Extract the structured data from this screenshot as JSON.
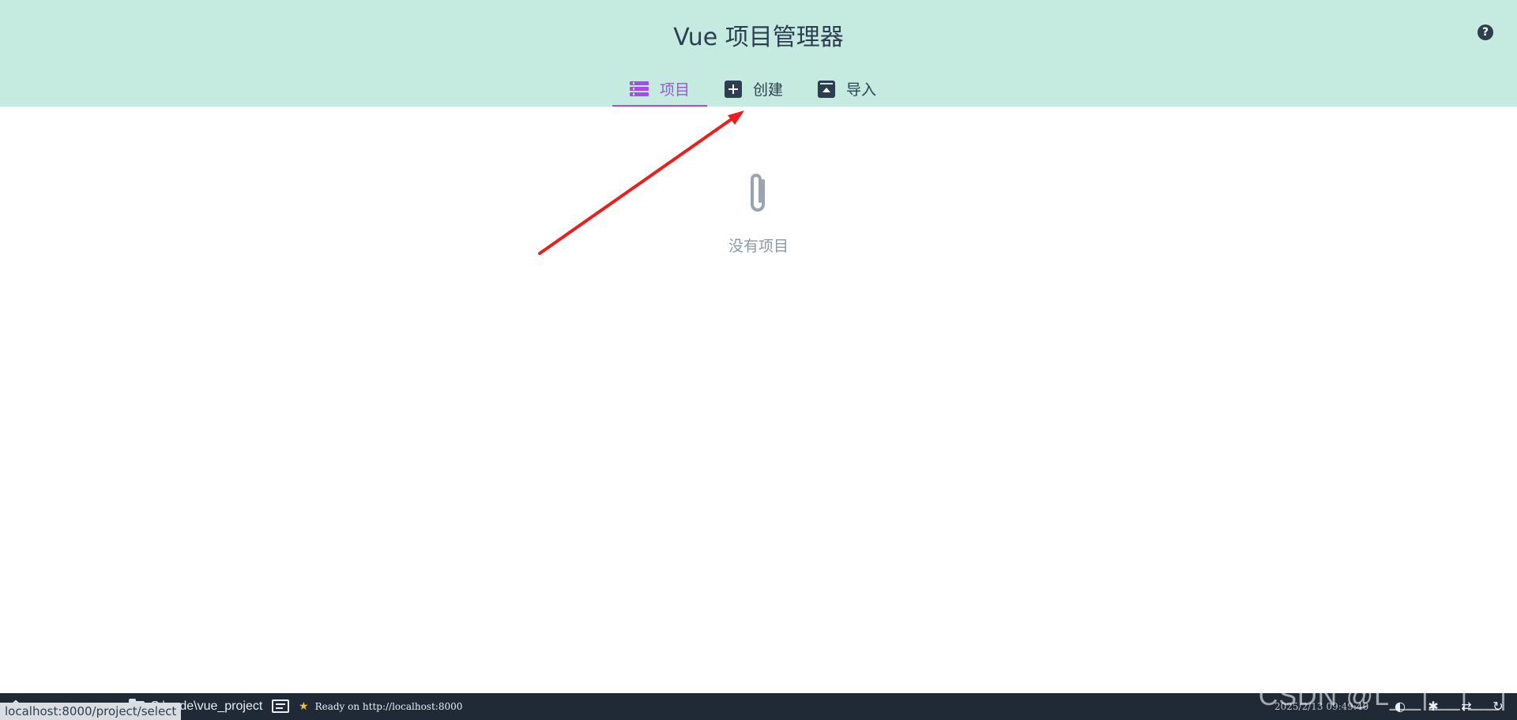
{
  "header": {
    "title": "Vue 项目管理器",
    "help_label": "?",
    "tabs": [
      {
        "label": "项目",
        "icon": "list-icon",
        "active": true
      },
      {
        "label": "创建",
        "icon": "plus-square-icon",
        "active": false
      },
      {
        "label": "导入",
        "icon": "archive-upload-icon",
        "active": false
      }
    ]
  },
  "main": {
    "empty_icon": "paperclip-icon",
    "empty_text": "没有项目"
  },
  "statusbar": {
    "url_preview": "localhost:8000/project/select",
    "folder_path": "C:\\code\\vue_project",
    "ready_text": "Ready on http://localhost:8000",
    "clock": "2025/2/13 09:49:40",
    "watermark": "CSDN @L__|__|__|"
  },
  "colors": {
    "header_bg": "#c5eadf",
    "accent": "#a44cf0",
    "text": "#2c3e50",
    "statusbar_bg": "#1f2a36",
    "annotation_arrow": "#ee1c1c"
  }
}
